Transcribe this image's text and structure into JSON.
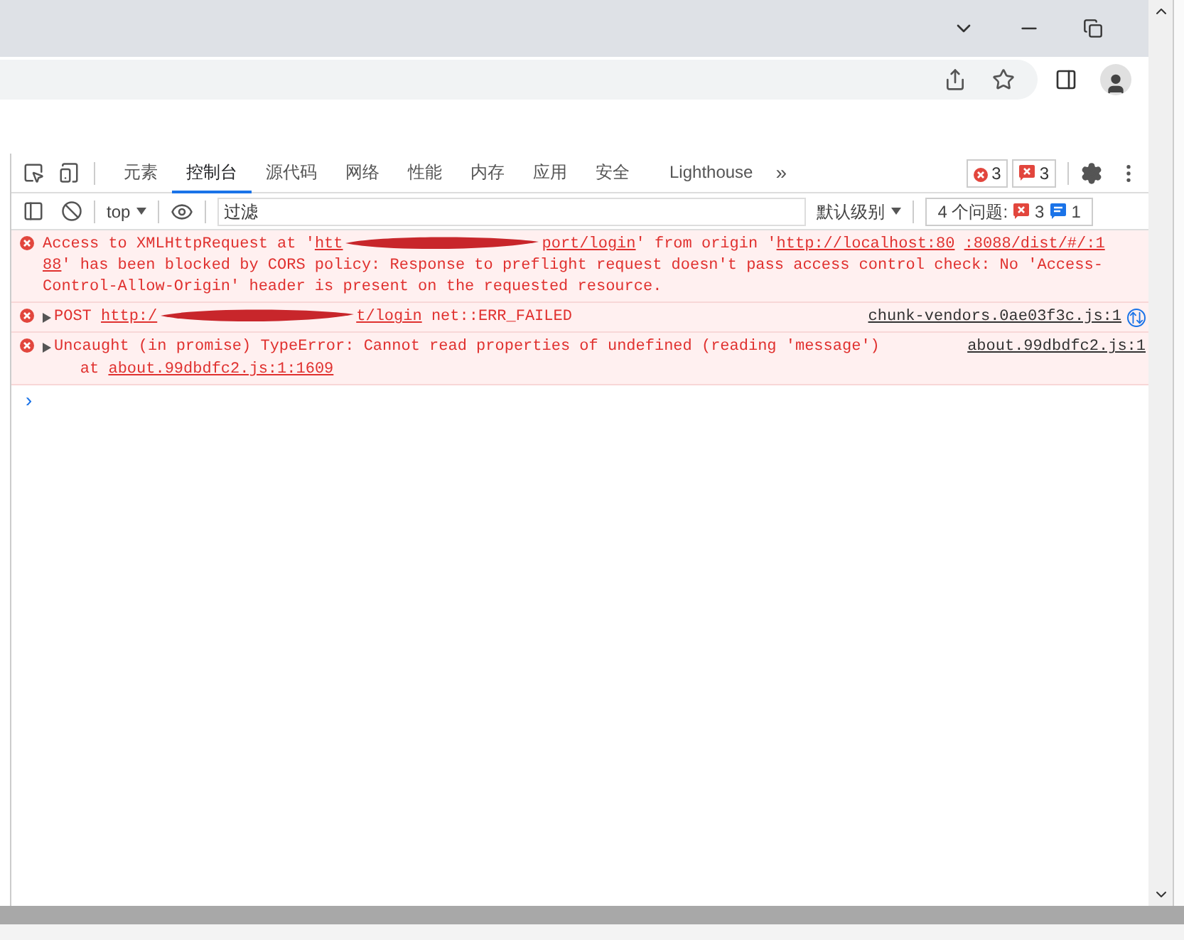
{
  "devtools": {
    "tabs": [
      {
        "label": "元素",
        "selected": false
      },
      {
        "label": "控制台",
        "selected": true
      },
      {
        "label": "源代码",
        "selected": false
      },
      {
        "label": "网络",
        "selected": false
      },
      {
        "label": "性能",
        "selected": false
      },
      {
        "label": "内存",
        "selected": false
      },
      {
        "label": "应用",
        "selected": false
      },
      {
        "label": "安全",
        "selected": false
      },
      {
        "label": "Lighthouse",
        "selected": false
      }
    ],
    "more_tabs": "»",
    "error_count": "3",
    "issue_count": "3",
    "toolbar": {
      "context": "top",
      "filter": {
        "placeholder": "过滤"
      },
      "level": "默认级别",
      "issues_label": "4 个问题:",
      "issues_errors": "3",
      "issues_info": "1"
    },
    "messages": [
      {
        "expandable": false,
        "network_icon": false,
        "lines": [
          [
            {
              "kind": "text",
              "text": "Access to XMLHttpRequest at '"
            },
            {
              "kind": "link",
              "text": "htt"
            },
            {
              "kind": "redacted"
            },
            {
              "kind": "link",
              "text": "port/login"
            },
            {
              "kind": "text",
              "text": "' from origin '"
            },
            {
              "kind": "link",
              "text": "http://localhost:80"
            },
            {
              "kind": "link",
              "text": ":8088/dist/#/:1"
            }
          ],
          [
            {
              "kind": "link",
              "text": "88"
            },
            {
              "kind": "text",
              "text": "' has been blocked by CORS policy: Response to preflight request doesn't pass access control check: No 'Access-"
            }
          ],
          [
            {
              "kind": "text",
              "text": "Control-Allow-Origin' header is present on the requested resource."
            }
          ]
        ]
      },
      {
        "expandable": true,
        "source": "chunk-vendors.0ae03f3c.js:1",
        "network_icon": true,
        "lines": [
          [
            {
              "kind": "text",
              "text": "POST "
            },
            {
              "kind": "link",
              "text": "http:/"
            },
            {
              "kind": "redacted"
            },
            {
              "kind": "link",
              "text": "t/login"
            },
            {
              "kind": "text",
              "text": " net::ERR_FAILED"
            }
          ]
        ]
      },
      {
        "expandable": true,
        "source": "about.99dbdfc2.js:1",
        "network_icon": false,
        "lines": [
          [
            {
              "kind": "text",
              "text": "Uncaught (in promise) TypeError: Cannot read properties of undefined (reading 'message')"
            }
          ],
          [
            {
              "kind": "text",
              "text": "    at "
            },
            {
              "kind": "link",
              "text": "about.99dbdfc2.js:1:1609"
            }
          ]
        ]
      }
    ],
    "prompt": "›"
  }
}
